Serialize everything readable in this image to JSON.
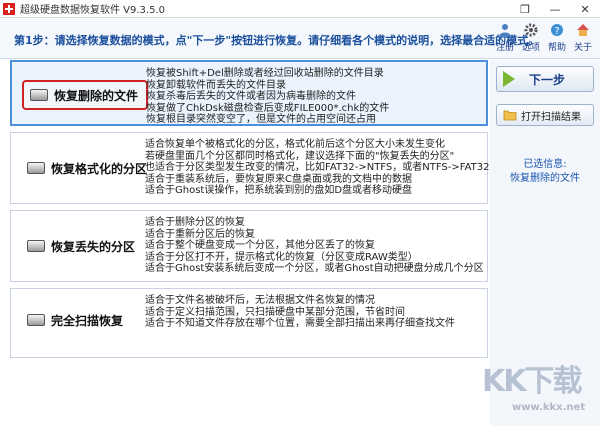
{
  "window": {
    "title": "超级硬盘数据恢复软件 V9.3.5.0",
    "controls": [
      "❐",
      "—",
      "✕"
    ]
  },
  "header": {
    "step_text": "第1步：请选择恢复数据的模式，点\"下一步\"按钮进行恢复。请仔细看各个模式的说明，选择最合适的模式。",
    "tools": [
      {
        "label": "注册",
        "icon": "user-icon"
      },
      {
        "label": "选项",
        "icon": "gear-icon"
      },
      {
        "label": "帮助",
        "icon": "help-icon"
      },
      {
        "label": "关于",
        "icon": "home-icon"
      }
    ]
  },
  "modes": [
    {
      "title": "恢复删除的文件",
      "icon": "hard-disk-icon",
      "selected": true,
      "lines": [
        "恢复被Shift+Del删除或者经过回收站删除的文件目录",
        "恢复卸载软件而丢失的文件目录",
        "恢复杀毒后丢失的文件或者因为病毒删除的文件",
        "恢复做了ChkDsk磁盘检查后变成FILE000*.chk的文件",
        "恢复根目录突然变空了，但是文件的占用空间还占用"
      ]
    },
    {
      "title": "恢复格式化的分区",
      "icon": "hard-disk-icon",
      "selected": false,
      "lines": [
        "适合恢复单个被格式化的分区，格式化前后这个分区大小未发生变化",
        "若硬盘里面几个分区都同时格式化，建议选择下面的\"恢复丢失的分区\"",
        "也适合于分区类型发生改变的情况，比如FAT32->NTFS，或者NTFS->FAT32",
        "适合于重装系统后，要恢复原来C盘桌面或我的文档中的数据",
        "适合于Ghost误操作，把系统装到别的盘如D盘或者移动硬盘"
      ]
    },
    {
      "title": "恢复丢失的分区",
      "icon": "hard-disk-icon",
      "selected": false,
      "lines": [
        "适合于删除分区的恢复",
        "适合于重新分区后的恢复",
        "适合于整个硬盘变成一个分区，其他分区丢了的恢复",
        "适合于分区打不开，提示格式化的恢复（分区变成RAW类型）",
        "适合于Ghost安装系统后变成一个分区，或者Ghost自动把硬盘分成几个分区"
      ]
    },
    {
      "title": "完全扫描恢复",
      "icon": "hard-disk-icon",
      "selected": false,
      "lines": [
        "适合于文件名被破坏后，无法根据文件名恢复的情况",
        "适合于定义扫描范围，只扫描硬盘中某部分范围，节省时间",
        "适合于不知道文件存放在哪个位置，需要全部扫描出来再仔细查找文件"
      ]
    }
  ],
  "right_panel": {
    "next_label": "下一步",
    "open_label": "打开扫描结果",
    "selected_info_label": "已选信息:",
    "selected_info_value": "恢复删除的文件"
  },
  "watermark": {
    "logo": "KK下载",
    "url": "www.kkx.net"
  }
}
